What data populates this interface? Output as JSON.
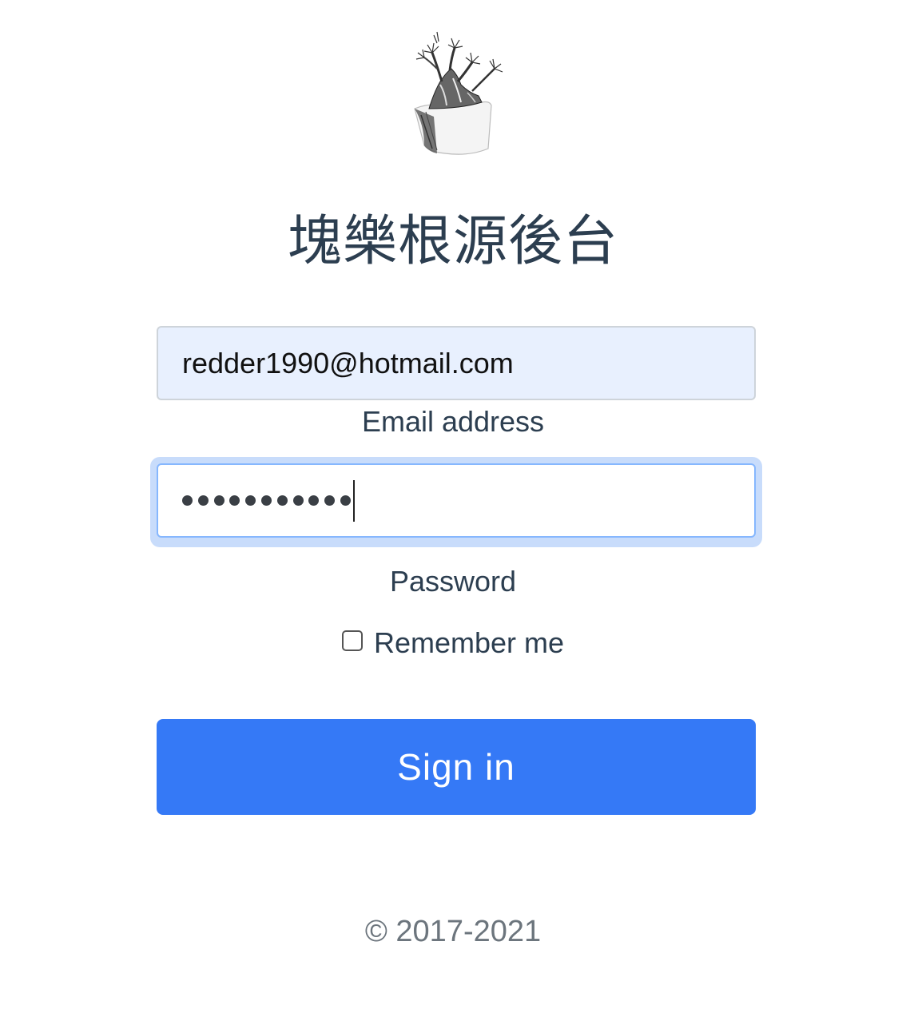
{
  "logo": {
    "icon": "bonsai-tree-pot-icon"
  },
  "title": "塊樂根源後台",
  "form": {
    "email_value": "redder1990@hotmail.com",
    "email_label": "Email address",
    "password_dot_count": 11,
    "password_label": "Password",
    "remember_label": "Remember me",
    "remember_checked": false,
    "signin_label": "Sign in"
  },
  "footer": {
    "copyright": "© 2017-2021"
  },
  "colors": {
    "primary_button": "#3579f6",
    "autofill_bg": "#e8f0fe",
    "focus_ring": "#c8dcfb",
    "title_text": "#2c3e50",
    "footer_text": "#6c757d"
  }
}
